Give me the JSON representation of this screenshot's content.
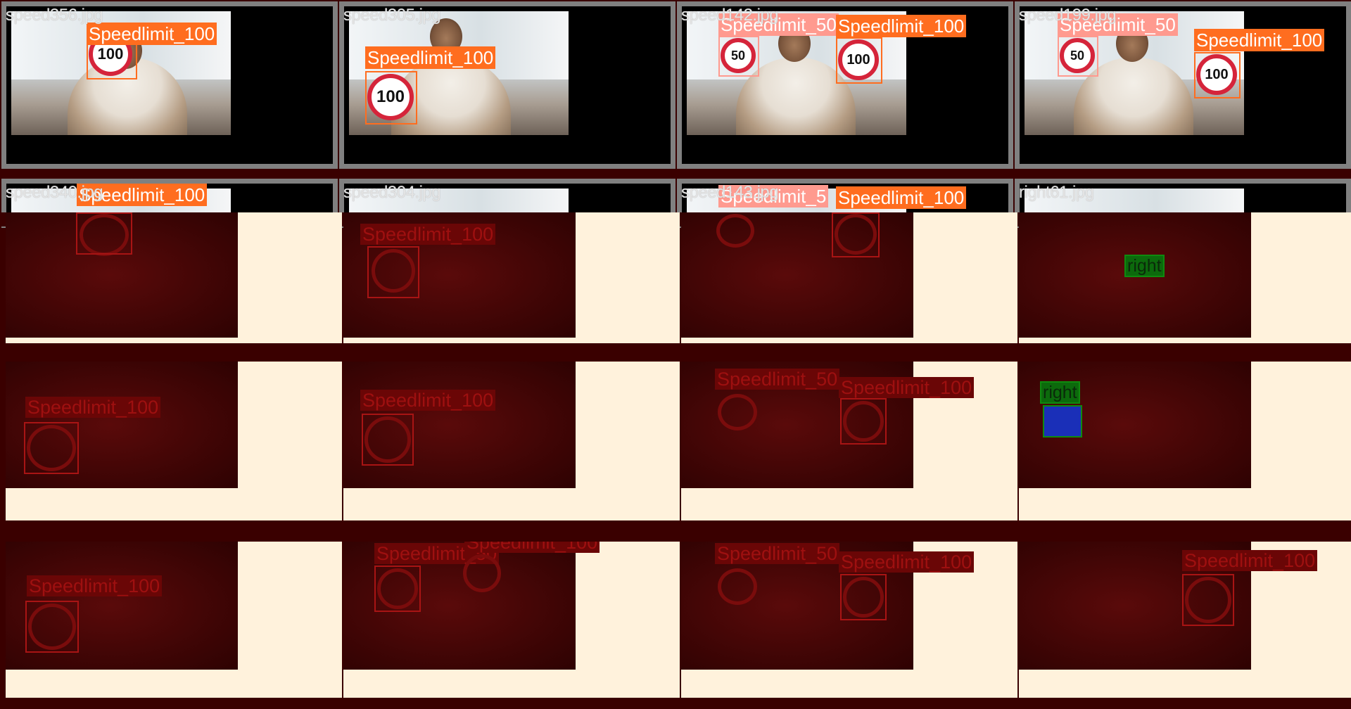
{
  "top_row": [
    {
      "filename": "speed356.jpg",
      "labels": [
        {
          "text": "Speedlimit_100",
          "color": "orange"
        }
      ],
      "sign_values": [
        "100"
      ]
    },
    {
      "filename": "speed305.jpg",
      "labels": [
        {
          "text": "Speedlimit_100",
          "color": "orange"
        }
      ],
      "sign_values": [
        "100"
      ]
    },
    {
      "filename": "speed142.jpg",
      "labels": [
        {
          "text": "Speedlimit_50",
          "color": "pink"
        },
        {
          "text": "Speedlimit_100",
          "color": "orange"
        }
      ],
      "sign_values": [
        "50",
        "100"
      ]
    },
    {
      "filename": "speed199.jpg",
      "labels": [
        {
          "text": "Speedlimit_50",
          "color": "pink"
        },
        {
          "text": "Speedlimit_100",
          "color": "orange"
        }
      ],
      "sign_values": [
        "50",
        "100"
      ]
    }
  ],
  "second_row": [
    {
      "filename": "speed340.jpg",
      "labels": [
        {
          "text": "Speedlimit_100",
          "color": "orange"
        }
      ]
    },
    {
      "filename": "speed304.jpg",
      "labels": []
    },
    {
      "filename": "speed143.jpg",
      "labels": [
        {
          "text": "Speedlimit_5",
          "color": "pink"
        },
        {
          "text": "Speedlimit_100",
          "color": "orange"
        }
      ]
    },
    {
      "filename": "right61.jpg",
      "labels": []
    }
  ],
  "red_row_1": [
    {
      "labels": []
    },
    {
      "labels": [
        "Speedlimit_100"
      ]
    },
    {
      "labels": []
    },
    {
      "labels": [
        "right"
      ]
    }
  ],
  "red_row_2": [
    {
      "labels": [
        "Speedlimit_100"
      ]
    },
    {
      "labels": [
        "Speedlimit_100"
      ]
    },
    {
      "labels": [
        "Speedlimit_50",
        "Speedlimit_100"
      ]
    },
    {
      "labels": [
        "right"
      ]
    }
  ],
  "red_row_3": [
    {
      "labels": [
        "Speedlimit_100"
      ]
    },
    {
      "labels": [
        "Speedlimit_50",
        "Speedlimit_100"
      ]
    },
    {
      "labels": [
        "Speedlimit_50",
        "Speedlimit_100"
      ]
    },
    {
      "labels": [
        "Speedlimit_100"
      ]
    }
  ],
  "colors": {
    "orange_label": "#ff6d1f",
    "pink_label": "#ff9a8f",
    "dark_red_bg": "#3a0000",
    "cream": "#fff2dc",
    "green_label": "#0c6a0c"
  }
}
